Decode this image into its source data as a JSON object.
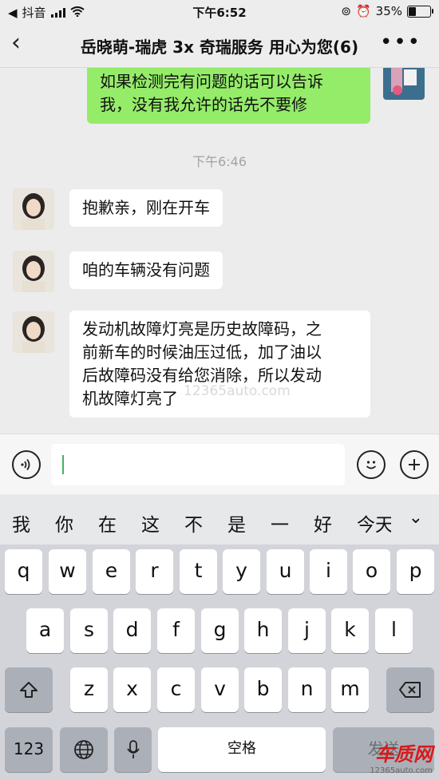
{
  "status_bar": {
    "app_label": "抖音",
    "time": "下午6:52",
    "battery": "35%",
    "battery_level": 0.35
  },
  "nav": {
    "back_icon": "chevron-left-icon",
    "title": "岳晓萌-瑞虎 3x 奇瑞服务 用心为您(6)",
    "more_icon": "more-dots-icon"
  },
  "messages": [
    {
      "sender": "me",
      "text_lines": [
        "如果检测完有问题的话可以告诉",
        "我，没有我允许的话先不要修"
      ]
    },
    {
      "type": "timestamp",
      "text": "下午6:46"
    },
    {
      "sender": "them",
      "text_lines": [
        "抱歉亲，刚在开车"
      ]
    },
    {
      "sender": "them",
      "text_lines": [
        "咱的车辆没有问题"
      ]
    },
    {
      "sender": "them",
      "text_lines": [
        "发动机故障灯亮是历史故障码，之",
        "前新车的时候油压过低，加了油以",
        "后故障码没有给您消除，所以发动",
        "机故障灯亮了"
      ]
    }
  ],
  "watermark": "12365auto.com",
  "input_bar": {
    "voice_icon": "voice-icon",
    "emoji_icon": "emoji-icon",
    "plus_icon": "plus-icon"
  },
  "suggestions": [
    "我",
    "你",
    "在",
    "这",
    "不",
    "是",
    "一",
    "好",
    "今天"
  ],
  "keyboard": {
    "row1": [
      "q",
      "w",
      "e",
      "r",
      "t",
      "y",
      "u",
      "i",
      "o",
      "p"
    ],
    "row2": [
      "a",
      "s",
      "d",
      "f",
      "g",
      "h",
      "j",
      "k",
      "l"
    ],
    "row3": [
      "z",
      "x",
      "c",
      "v",
      "b",
      "n",
      "m"
    ],
    "numbers_label": "123",
    "space_label": "空格",
    "send_label": "发送"
  },
  "logo": {
    "name": "车质网",
    "url": "12365auto.com"
  }
}
